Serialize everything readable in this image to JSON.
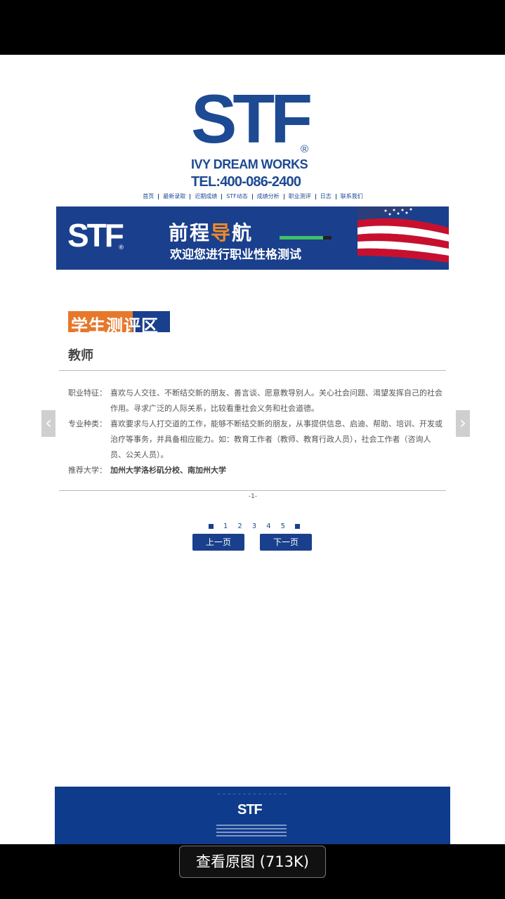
{
  "header": {
    "logo_text": "STF",
    "logo_reg": "®",
    "logo_sub": "IVY DREAM WORKS",
    "tel": "TEL:400-086-2400"
  },
  "nav": {
    "items": [
      "首页",
      "最新录取",
      "近期成绩",
      "STF动态",
      "成绩分析",
      "职业测评",
      "日志",
      "联系我们"
    ]
  },
  "banner": {
    "logo": "STF",
    "logo_reg": "®",
    "title_part1": "前程",
    "title_highlight": "导",
    "title_part2": "航",
    "subtitle": "欢迎您进行职业性格测试"
  },
  "section": {
    "tag": "学生测评区",
    "job_title": "教师"
  },
  "details": {
    "trait_label": "职业特征：",
    "trait_text": "喜欢与人交往、不断结交新的朋友、善言谈、愿意教导别人。关心社会问题、渴望发挥自己的社会作用。寻求广泛的人际关系，比较看重社会义务和社会道德。",
    "type_label": "专业种类：",
    "type_text": "喜欢要求与人打交道的工作，能够不断结交新的朋友，从事提供信息、启迪、帮助、培训、开发或治疗等事务，并具备相应能力。如：教育工作者（教师、教育行政人员），社会工作者（咨询人员、公关人员）。",
    "univ_label": "推荐大学：",
    "univ_text": "加州大学洛杉矶分校、南加州大学"
  },
  "page_indicator": "-1-",
  "pager": {
    "pages": [
      "1",
      "2",
      "3",
      "4",
      "5"
    ],
    "prev_label": "上一页",
    "next_label": "下一页"
  },
  "footer": {
    "logo": "STF"
  },
  "view_original": "查看原图 (713K)",
  "colors": {
    "brand_blue": "#1d4a92",
    "banner_blue": "#1a3f8c",
    "accent_orange": "#e6782b"
  }
}
